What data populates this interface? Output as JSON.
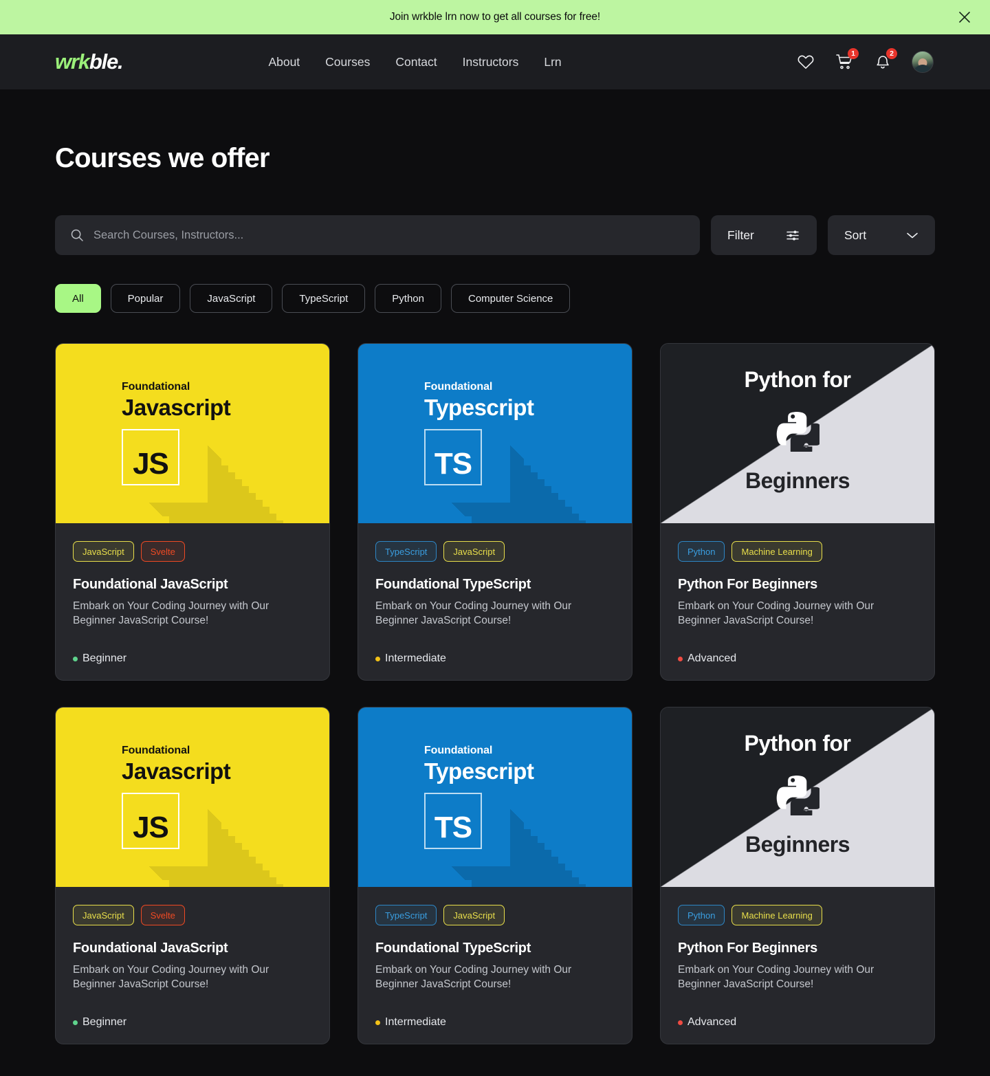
{
  "banner": {
    "text": "Join wrkble lrn now to get all courses for free!",
    "background_color": "#bdf5a1",
    "close_icon": "close-icon"
  },
  "header": {
    "logo": {
      "accent": "wrk",
      "rest": "ble.",
      "accent_color": "#9bf07a"
    },
    "nav": [
      {
        "label": "About"
      },
      {
        "label": "Courses"
      },
      {
        "label": "Contact"
      },
      {
        "label": "Instructors"
      },
      {
        "label": "Lrn"
      }
    ],
    "actions": {
      "wishlist_icon": "heart-icon",
      "cart_icon": "cart-icon",
      "cart_badge": "1",
      "notifications_icon": "bell-icon",
      "notifications_badge": "2",
      "avatar": "user-avatar",
      "badge_color": "#e8342b"
    }
  },
  "main": {
    "title": "Courses we offer",
    "search": {
      "placeholder": "Search Courses, Instructors...",
      "value": "",
      "icon": "search-icon"
    },
    "filter_button": {
      "label": "Filter",
      "icon": "sliders-icon"
    },
    "sort_button": {
      "label": "Sort",
      "icon": "chevron-down-icon"
    },
    "pills": [
      {
        "label": "All",
        "active": true
      },
      {
        "label": "Popular",
        "active": false
      },
      {
        "label": "JavaScript",
        "active": false
      },
      {
        "label": "TypeScript",
        "active": false
      },
      {
        "label": "Python",
        "active": false
      },
      {
        "label": "Computer  Science",
        "active": false
      }
    ],
    "active_pill_color": "#a8f785"
  },
  "courses": [
    {
      "thumb_kind": "js",
      "thumb_kicker": "Foundational",
      "thumb_lang": "Javascript",
      "thumb_badge": "JS",
      "thumb_color": "#f4dd1e",
      "tags": [
        {
          "label": "JavaScript",
          "style": "javascript"
        },
        {
          "label": "Svelte",
          "style": "svelte"
        }
      ],
      "title": "Foundational JavaScript",
      "description": "Embark on Your Coding Journey with Our Beginner JavaScript Course!",
      "level": "Beginner",
      "level_color": "#5fd38d"
    },
    {
      "thumb_kind": "ts",
      "thumb_kicker": "Foundational",
      "thumb_lang": "Typescript",
      "thumb_badge": "TS",
      "thumb_color": "#0d7cc8",
      "tags": [
        {
          "label": "TypeScript",
          "style": "typescript"
        },
        {
          "label": "JavaScript",
          "style": "ml"
        }
      ],
      "title": "Foundational TypeScript",
      "description": "Embark on Your Coding Journey with Our Beginner JavaScript Course!",
      "level": "Intermediate",
      "level_color": "#f2c117"
    },
    {
      "thumb_kind": "py",
      "thumb_top": "Python for",
      "thumb_bottom": "Beginners",
      "thumb_logo": "python-logo-icon",
      "thumb_color": "#dcdce2",
      "tags": [
        {
          "label": "Python",
          "style": "python"
        },
        {
          "label": "Machine Learning",
          "style": "ml"
        }
      ],
      "title": "Python For Beginners",
      "description": "Embark on Your Coding Journey with Our Beginner JavaScript Course!",
      "level": "Advanced",
      "level_color": "#ef4b42"
    },
    {
      "thumb_kind": "js",
      "thumb_kicker": "Foundational",
      "thumb_lang": "Javascript",
      "thumb_badge": "JS",
      "thumb_color": "#f4dd1e",
      "tags": [
        {
          "label": "JavaScript",
          "style": "javascript"
        },
        {
          "label": "Svelte",
          "style": "svelte"
        }
      ],
      "title": "Foundational JavaScript",
      "description": "Embark on Your Coding Journey with Our Beginner JavaScript Course!",
      "level": "Beginner",
      "level_color": "#5fd38d"
    },
    {
      "thumb_kind": "ts",
      "thumb_kicker": "Foundational",
      "thumb_lang": "Typescript",
      "thumb_badge": "TS",
      "thumb_color": "#0d7cc8",
      "tags": [
        {
          "label": "TypeScript",
          "style": "typescript"
        },
        {
          "label": "JavaScript",
          "style": "ml"
        }
      ],
      "title": "Foundational TypeScript",
      "description": "Embark on Your Coding Journey with Our Beginner JavaScript Course!",
      "level": "Intermediate",
      "level_color": "#f2c117"
    },
    {
      "thumb_kind": "py",
      "thumb_top": "Python for",
      "thumb_bottom": "Beginners",
      "thumb_logo": "python-logo-icon",
      "thumb_color": "#dcdce2",
      "tags": [
        {
          "label": "Python",
          "style": "python"
        },
        {
          "label": "Machine Learning",
          "style": "ml"
        }
      ],
      "title": "Python For Beginners",
      "description": "Embark on Your Coding Journey with Our Beginner JavaScript Course!",
      "level": "Advanced",
      "level_color": "#ef4b42"
    }
  ]
}
